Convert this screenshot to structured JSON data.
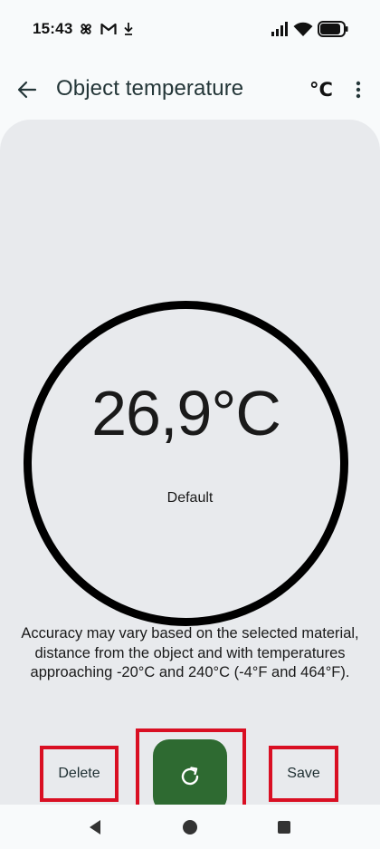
{
  "status_bar": {
    "time": "15:43",
    "icons": [
      "pinwheel-icon",
      "gmail-icon",
      "download-icon",
      "signal-icon",
      "wifi-icon",
      "battery-icon"
    ]
  },
  "app_bar": {
    "title": "Object temperature",
    "unit_toggle": "°C"
  },
  "reading": {
    "temperature": "26,9°C",
    "material": "Default"
  },
  "accuracy_note": "Accuracy may vary based on the selected material, distance from the object and with temperatures approaching -20°C and 240°C (-4°F and 464°F).",
  "actions": {
    "delete_label": "Delete",
    "save_label": "Save",
    "refresh_icon": "refresh-icon"
  },
  "colors": {
    "accent_green": "#2e6a31",
    "highlight_red": "#d90f23",
    "card_background": "#e8eaed"
  },
  "nav_bar": {
    "buttons": [
      "back-nav-icon",
      "home-nav-icon",
      "recents-nav-icon"
    ]
  }
}
